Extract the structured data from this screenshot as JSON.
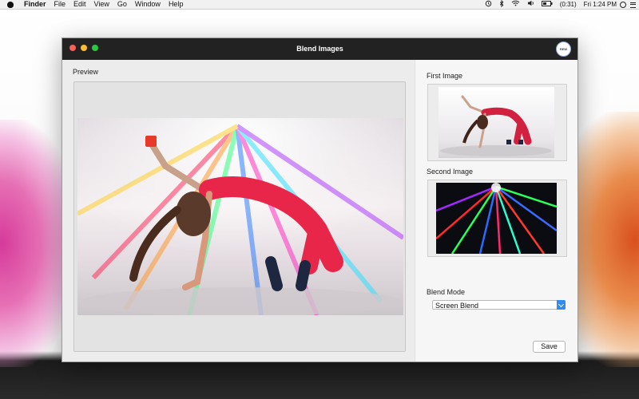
{
  "menubar": {
    "app": "Finder",
    "items": [
      "File",
      "Edit",
      "View",
      "Go",
      "Window",
      "Help"
    ],
    "battery": "(0:31)",
    "clock": "Fri 1:24 PM"
  },
  "window": {
    "title": "Blend Images",
    "badge": "REW"
  },
  "preview": {
    "label": "Preview"
  },
  "first_image": {
    "label": "First Image"
  },
  "second_image": {
    "label": "Second Image"
  },
  "blend_mode": {
    "label": "Blend Mode",
    "value": "Screen Blend"
  },
  "save_label": "Save",
  "colors": {
    "titlebar": "#222222",
    "accent": "#2f8cf2",
    "close": "#fc5f57",
    "minimize": "#fdbc2e",
    "zoom": "#28c840"
  }
}
